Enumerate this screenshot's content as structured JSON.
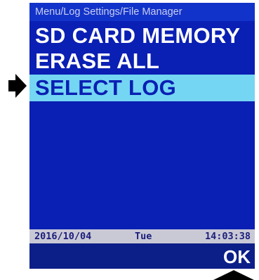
{
  "breadcrumb": "Menu/Log Settings/File Manager",
  "menu": {
    "items": [
      {
        "label": "SD CARD MEMORY",
        "selected": false
      },
      {
        "label": "ERASE  ALL",
        "selected": false
      },
      {
        "label": "SELECT  LOG",
        "selected": true
      }
    ]
  },
  "status_bar": {
    "date": "2016/10/04",
    "day": "Tue",
    "time": "14:03:38"
  },
  "softkey": {
    "ok_label": "OK"
  },
  "colors": {
    "screen_background": "#0a1fb3",
    "selection_highlight": "#74d6f3",
    "status_bar": "#c9c9d6",
    "footer": "#0c1f88"
  },
  "icons": {
    "selection_pointer": "right-arrow-icon",
    "ok_indicator": "up-arrow-icon"
  }
}
